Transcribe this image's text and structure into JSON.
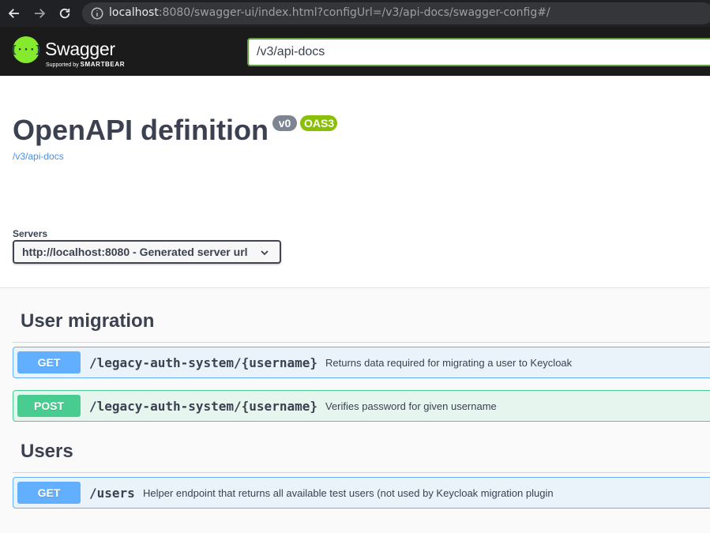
{
  "browser": {
    "url_host": "localhost",
    "url_rest": ":8080/swagger-ui/index.html?configUrl=/v3/api-docs/swagger-config#/"
  },
  "topbar": {
    "logo_text": "Swagger",
    "logo_glyph": "{···}",
    "logo_sub_prefix": "Supported by",
    "logo_sub_brand": "SMARTBEAR",
    "spec_url": "/v3/api-docs",
    "accent_color": "#85ea2d"
  },
  "info": {
    "title": "OpenAPI definition",
    "version": "v0",
    "oas": "OAS3",
    "spec_link": "/v3/api-docs"
  },
  "servers": {
    "label": "Servers",
    "selected": "http://localhost:8080 - Generated server url"
  },
  "tags": [
    {
      "name": "User migration",
      "operations": [
        {
          "method": "GET",
          "path": "/legacy-auth-system/{username}",
          "summary": "Returns data required for migrating a user to Keycloak"
        },
        {
          "method": "POST",
          "path": "/legacy-auth-system/{username}",
          "summary": "Verifies password for given username"
        }
      ]
    },
    {
      "name": "Users",
      "operations": [
        {
          "method": "GET",
          "path": "/users",
          "summary": "Helper endpoint that returns all available test users (not used by Keycloak migration plugin"
        }
      ]
    }
  ],
  "colors": {
    "get": "#61affe",
    "post": "#49cc90",
    "text": "#3b4151"
  }
}
